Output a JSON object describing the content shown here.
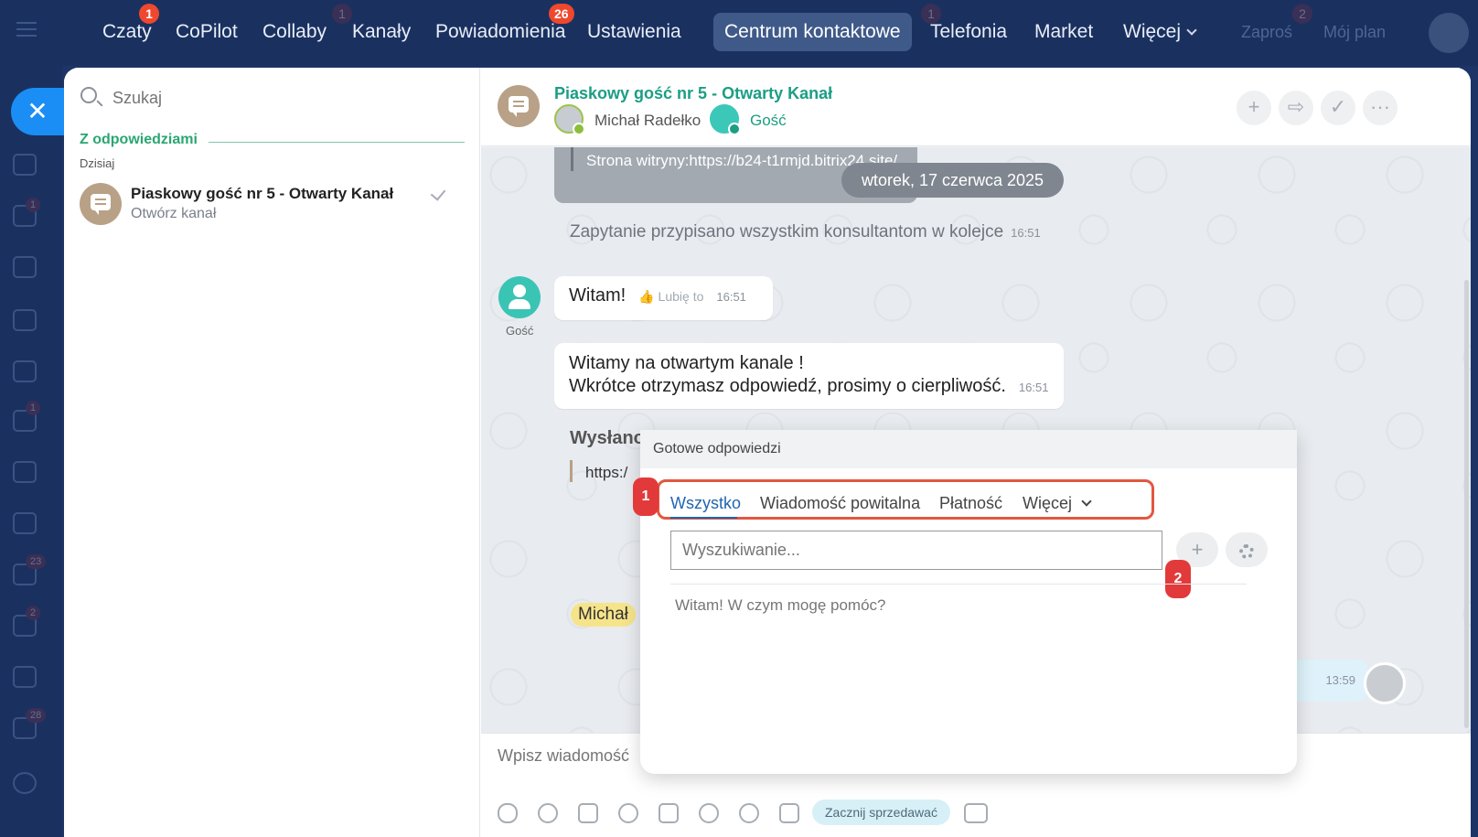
{
  "topnav": {
    "items": [
      {
        "label": "Czaty",
        "badge": "1"
      },
      {
        "label": "CoPilot"
      },
      {
        "label": "Collaby",
        "badge": "1"
      },
      {
        "label": "Kanały"
      },
      {
        "label": "Powiadomienia",
        "badge": "26"
      },
      {
        "label": "Ustawienia"
      },
      {
        "label": "Centrum kontaktowe",
        "active": true
      },
      {
        "label": "Telefonia",
        "badge": "1"
      },
      {
        "label": "Market"
      },
      {
        "label": "Więcej"
      }
    ],
    "right": {
      "invite_label": "Zaproś",
      "invite_badge": "2",
      "plan_label": "Mój plan"
    }
  },
  "leftbar": {
    "badges": [
      "1",
      "1",
      "23",
      "2",
      "28"
    ]
  },
  "chatlist": {
    "search_placeholder": "Szukaj",
    "section_title": "Z odpowiedziami",
    "section_sub": "Dzisiaj",
    "items": [
      {
        "name": "Piaskowy gość nr 5 - Otwarty Kanał",
        "subtitle": "Otwórz kanał"
      }
    ]
  },
  "chat": {
    "title": "Piaskowy gość nr 5 - Otwarty Kanał",
    "members": [
      {
        "name": "Michał Radełko"
      },
      {
        "name": "Gość"
      }
    ],
    "old_message_text": "Strona witryny:https://b24-t1rmjd.bitrix24.site/",
    "date_pill": "wtorek, 17 czerwca 2025",
    "system_message": {
      "text": "Zapytanie przypisano wszystkim konsultantom w kolejce",
      "time": "16:51"
    },
    "guest_label": "Gość",
    "message1": {
      "text": "Witam!",
      "like": "Lubię to",
      "time": "16:51"
    },
    "message2": {
      "line1": "Witamy na otwartym kanale !",
      "line2": "Wkrótce otrzymasz odpowiedź, prosimy o cierpliwość.",
      "time": "16:51"
    },
    "partial_title": "Wysłano",
    "partial_link": "https:/",
    "mention": "Michał",
    "right_msg_time": "13:59",
    "composer_placeholder": "Wpisz wiadomość",
    "sell_button": "Zacznij sprzedawać"
  },
  "popup": {
    "title": "Gotowe odpowiedzi",
    "tabs": [
      "Wszystko",
      "Wiadomość powitalna",
      "Płatność",
      "Więcej"
    ],
    "active_tab": "Wszystko",
    "search_placeholder": "Wyszukiwanie...",
    "answers": [
      "Witam! W czym mogę pomóc?"
    ],
    "markers": [
      "1",
      "2"
    ]
  },
  "colors": {
    "accent": "#1b9e84",
    "nav_bg": "#1a3160",
    "highlight": "#e2573f"
  }
}
